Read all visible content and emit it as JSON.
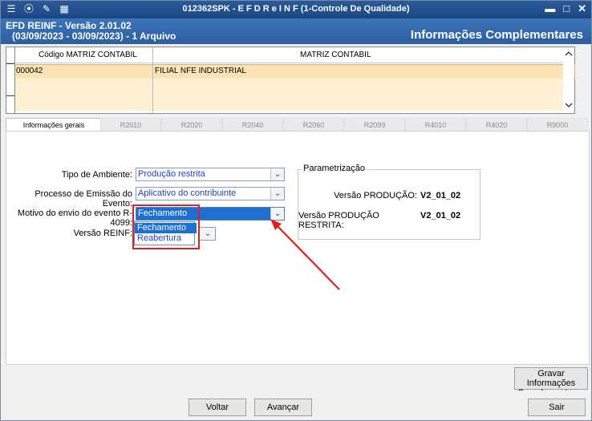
{
  "titlebar": {
    "title": "012362SPK - E F D  R e I N F (1-Controle De Qualidade)",
    "icons": [
      "menu-icon",
      "traffic-light-icon",
      "wrench-icon",
      "calculator-icon"
    ],
    "min": "▬",
    "max": "□",
    "close": "✕"
  },
  "header": {
    "line1": "EFD REINF - Versão 2.01.02",
    "line2": "(03/09/2023 - 03/09/2023) - 1 Arquivo",
    "right_title": "Informações Complementares"
  },
  "grid": {
    "columns": [
      "Código MATRIZ CONTABIL",
      "MATRIZ CONTABIL"
    ],
    "rows": [
      {
        "code": "000042",
        "name": "FILIAL NFE INDUSTRIAL"
      }
    ]
  },
  "tabs": [
    {
      "label": "Informações gerais",
      "active": true
    },
    {
      "label": "R2010"
    },
    {
      "label": "R2020"
    },
    {
      "label": "R2040"
    },
    {
      "label": "R2060"
    },
    {
      "label": "R2099"
    },
    {
      "label": "R4010"
    },
    {
      "label": "R4020"
    },
    {
      "label": "R9000"
    }
  ],
  "form": {
    "tipo_ambiente_label": "Tipo de Ambiente:",
    "tipo_ambiente_value": "Produção restrita",
    "processo_label": "Processo de Emissão do Evento:",
    "processo_value": "Aplicativo do contribuinte",
    "motivo_label": "Motivo do envio do evento R-4099:",
    "motivo_value": "Fechamento",
    "versao_label": "Versão REINF:",
    "motivo_options": [
      "Fechamento",
      "Reabertura"
    ]
  },
  "parametrizacao": {
    "legend": "Parametrização",
    "producao_label": "Versão PRODUÇÃO:",
    "producao_value": "V2_01_02",
    "restrita_label": "Versão PRODUÇÃO RESTRITA:",
    "restrita_value": "V2_01_02"
  },
  "buttons": {
    "gravar_line1": "Gravar Informações",
    "gravar_line2": "Complementares",
    "voltar": "Voltar",
    "avancar": "Avançar",
    "sair": "Sair"
  },
  "colors": {
    "titlebar": "#1b4683",
    "selection": "#1d6fd4",
    "highlight_box": "#e02020",
    "arrow": "#e02020"
  }
}
